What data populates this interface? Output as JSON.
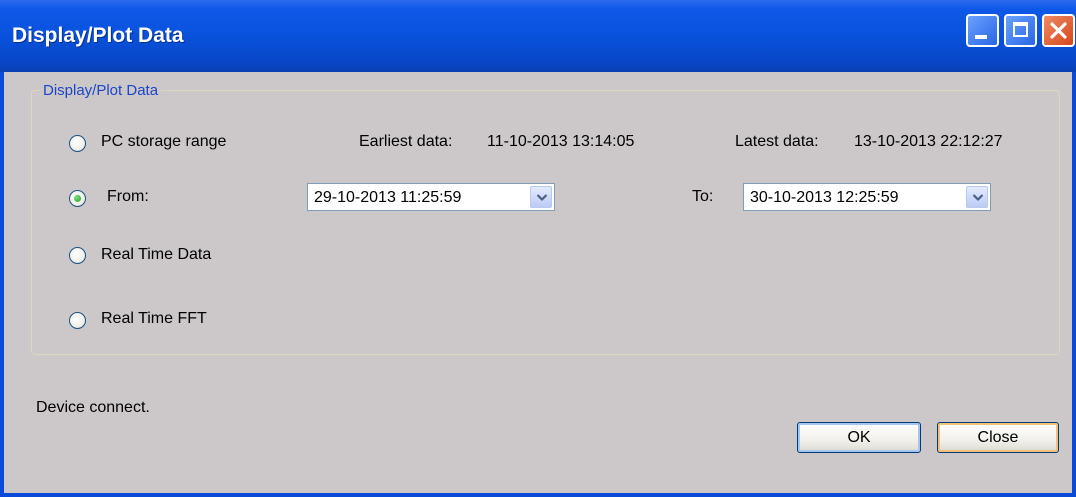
{
  "window": {
    "title": "Display/Plot Data",
    "colors": {
      "titlebar": "#0953df",
      "body": "#ccc8c9",
      "legend": "#1c46c7"
    }
  },
  "group": {
    "legend": "Display/Plot Data",
    "options": {
      "pc_storage_range": {
        "label": "PC storage range",
        "selected": false
      },
      "from": {
        "label": "From:",
        "selected": true
      },
      "real_time_data": {
        "label": "Real Time Data",
        "selected": false
      },
      "real_time_fft": {
        "label": "Real Time FFT",
        "selected": false
      }
    },
    "earliest": {
      "label": "Earliest data:",
      "value": "11-10-2013 13:14:05"
    },
    "latest": {
      "label": "Latest data:",
      "value": "13-10-2013 22:12:27"
    },
    "from_value": "29-10-2013 11:25:59",
    "to_label": "To:",
    "to_value": "30-10-2013 12:25:59"
  },
  "status": "Device connect.",
  "buttons": {
    "ok": "OK",
    "close": "Close"
  }
}
